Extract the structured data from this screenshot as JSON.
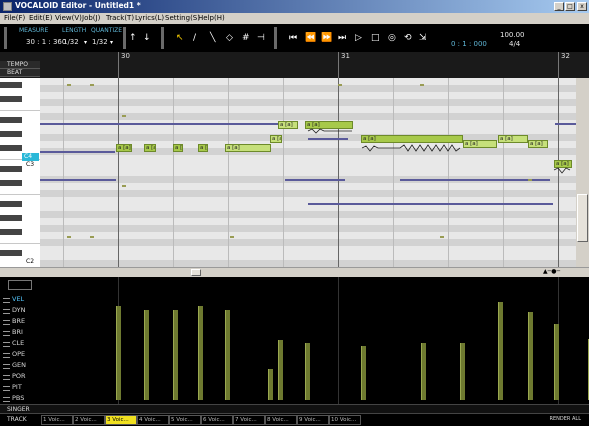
{
  "window": {
    "title": "VOCALOID Editor - Untitled1 *",
    "minimize": "_",
    "maximize": "□",
    "close": "x"
  },
  "menu": [
    "File(F)",
    "Edit(E)",
    "View(V)",
    "Job(J)",
    "Track(T)",
    "Lyrics(L)",
    "Setting(S)",
    "Help(H)"
  ],
  "toolbar": {
    "measure_label": "MEASURE",
    "length_label": "LENGTH",
    "quantize_label": "QUANTIZE",
    "measure_value": "30 : 1 : 360",
    "length_value": "1/32",
    "quantize_value": "1/32",
    "tempo_value": "100.00",
    "time_value": "0 : 1 : 000",
    "signature_value": "4/4"
  },
  "ruler": {
    "tempo_label": "TEMPO",
    "beat_label": "BEAT",
    "measures": [
      "30",
      "31",
      "32"
    ]
  },
  "piano": {
    "c4_label": "C4",
    "c3_label": "C3",
    "c2_label": "C2"
  },
  "notes": [
    {
      "lyric": "a [a]"
    },
    {
      "lyric": "a [a]"
    },
    {
      "lyric": "a [a]"
    },
    {
      "lyric": "a [a]"
    },
    {
      "lyric": "a [a]"
    },
    {
      "lyric": "a [a]"
    },
    {
      "lyric": "a [a]"
    },
    {
      "lyric": "a [a]"
    },
    {
      "lyric": "a [a]"
    },
    {
      "lyric": "a [a]"
    },
    {
      "lyric": "a [a]"
    },
    {
      "lyric": "a [a]"
    },
    {
      "lyric": "a [a]"
    }
  ],
  "controls": [
    "VEL",
    "DYN",
    "BRE",
    "BRI",
    "CLE",
    "OPE",
    "GEN",
    "POR",
    "PIT",
    "PBS"
  ],
  "active_control": "VEL",
  "singer_label": "SINGER",
  "track_label": "TRACK",
  "tracks": [
    "1 Voic...",
    "2 Voic...",
    "3 Voic...",
    "4 Voic...",
    "5 Voic...",
    "6 Voic...",
    "7 Voic...",
    "8 Voic...",
    "9 Voic...",
    "10 Voic..."
  ],
  "active_track": 3,
  "render_label": "RENDER ALL",
  "velocity_values": [
    0.79,
    0.76,
    0.76,
    0.79,
    0.76,
    0.26,
    0.5,
    0.48,
    0.45,
    0.48,
    0.48,
    0.82,
    0.74,
    0.64,
    0.51
  ],
  "colors": {
    "note": "#c6e07a",
    "velocity": "#6e7a30",
    "accent": "#2ab8d8",
    "active_track": "#f0e020"
  }
}
